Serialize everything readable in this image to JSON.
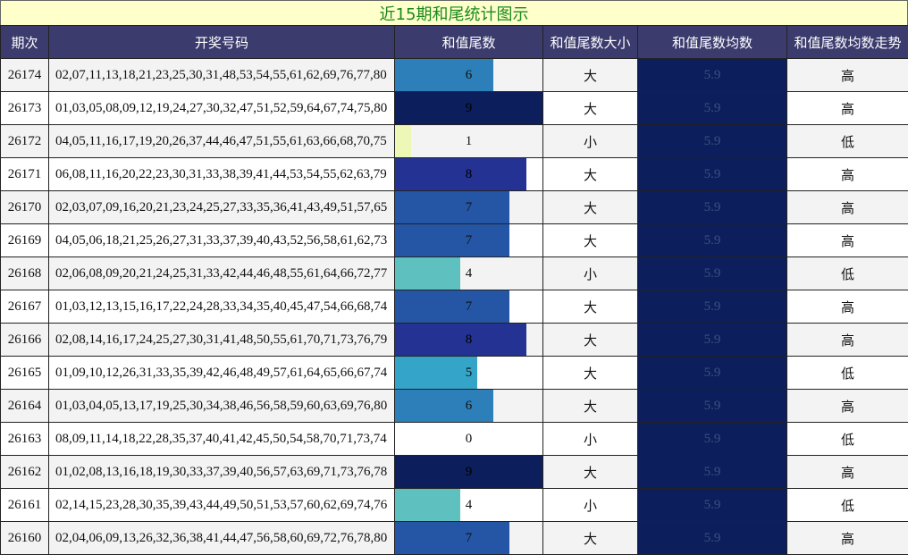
{
  "title": "近15期和尾统计图示",
  "headers": [
    "期次",
    "开奖号码",
    "和值尾数",
    "和值尾数大小",
    "和值尾数均数",
    "和值尾数均数走势"
  ],
  "max_tail": 9,
  "rows": [
    {
      "period": "26174",
      "numbers": "02,07,11,13,18,21,23,25,30,31,48,53,54,55,61,62,69,76,77,80",
      "tail": 6,
      "tail_label": "6",
      "size": "大",
      "avg": "5.9",
      "trend": "高",
      "color": "#2c7fb8"
    },
    {
      "period": "26173",
      "numbers": "01,03,05,08,09,12,19,24,27,30,32,47,51,52,59,64,67,74,75,80",
      "tail": 9,
      "tail_label": "9",
      "size": "大",
      "avg": "5.9",
      "trend": "高",
      "color": "#0c1e5b"
    },
    {
      "period": "26172",
      "numbers": "04,05,11,16,17,19,20,26,37,44,46,47,51,55,61,63,66,68,70,75",
      "tail": 1,
      "tail_label": "1",
      "size": "小",
      "avg": "5.9",
      "trend": "低",
      "color": "#eef8b6"
    },
    {
      "period": "26171",
      "numbers": "06,08,11,16,20,22,23,30,31,33,38,39,41,44,53,54,55,62,63,79",
      "tail": 8,
      "tail_label": "8",
      "size": "大",
      "avg": "5.9",
      "trend": "高",
      "color": "#243294"
    },
    {
      "period": "26170",
      "numbers": "02,03,07,09,16,20,21,23,24,25,27,33,35,36,41,43,49,51,57,65",
      "tail": 7,
      "tail_label": "7",
      "size": "大",
      "avg": "5.9",
      "trend": "高",
      "color": "#2556a6"
    },
    {
      "period": "26169",
      "numbers": "04,05,06,18,21,25,26,27,31,33,37,39,40,43,52,56,58,61,62,73",
      "tail": 7,
      "tail_label": "7",
      "size": "大",
      "avg": "5.9",
      "trend": "高",
      "color": "#2556a6"
    },
    {
      "period": "26168",
      "numbers": "02,06,08,09,20,21,24,25,31,33,42,44,46,48,55,61,64,66,72,77",
      "tail": 4,
      "tail_label": "4",
      "size": "小",
      "avg": "5.9",
      "trend": "低",
      "color": "#5ec1c0"
    },
    {
      "period": "26167",
      "numbers": "01,03,12,13,15,16,17,22,24,28,33,34,35,40,45,47,54,66,68,74",
      "tail": 7,
      "tail_label": "7",
      "size": "大",
      "avg": "5.9",
      "trend": "高",
      "color": "#2556a6"
    },
    {
      "period": "26166",
      "numbers": "02,08,14,16,17,24,25,27,30,31,41,48,50,55,61,70,71,73,76,79",
      "tail": 8,
      "tail_label": "8",
      "size": "大",
      "avg": "5.9",
      "trend": "高",
      "color": "#243294"
    },
    {
      "period": "26165",
      "numbers": "01,09,10,12,26,31,33,35,39,42,46,48,49,57,61,64,65,66,67,74",
      "tail": 5,
      "tail_label": "5",
      "size": "大",
      "avg": "5.9",
      "trend": "低",
      "color": "#34a5c8"
    },
    {
      "period": "26164",
      "numbers": "01,03,04,05,13,17,19,25,30,34,38,46,56,58,59,60,63,69,76,80",
      "tail": 6,
      "tail_label": "6",
      "size": "大",
      "avg": "5.9",
      "trend": "高",
      "color": "#2c7fb8"
    },
    {
      "period": "26163",
      "numbers": "08,09,11,14,18,22,28,35,37,40,41,42,45,50,54,58,70,71,73,74",
      "tail": 0,
      "tail_label": "0",
      "size": "小",
      "avg": "5.9",
      "trend": "低",
      "color": "#ffffff"
    },
    {
      "period": "26162",
      "numbers": "01,02,08,13,16,18,19,30,33,37,39,40,56,57,63,69,71,73,76,78",
      "tail": 9,
      "tail_label": "9",
      "size": "大",
      "avg": "5.9",
      "trend": "高",
      "color": "#0c1e5b"
    },
    {
      "period": "26161",
      "numbers": "02,14,15,23,28,30,35,39,43,44,49,50,51,53,57,60,62,69,74,76",
      "tail": 4,
      "tail_label": "4",
      "size": "小",
      "avg": "5.9",
      "trend": "低",
      "color": "#5ec1c0"
    },
    {
      "period": "26160",
      "numbers": "02,04,06,09,13,26,32,36,38,41,44,47,56,58,60,69,72,76,78,80",
      "tail": 7,
      "tail_label": "7",
      "size": "大",
      "avg": "5.9",
      "trend": "高",
      "color": "#2556a6"
    }
  ]
}
